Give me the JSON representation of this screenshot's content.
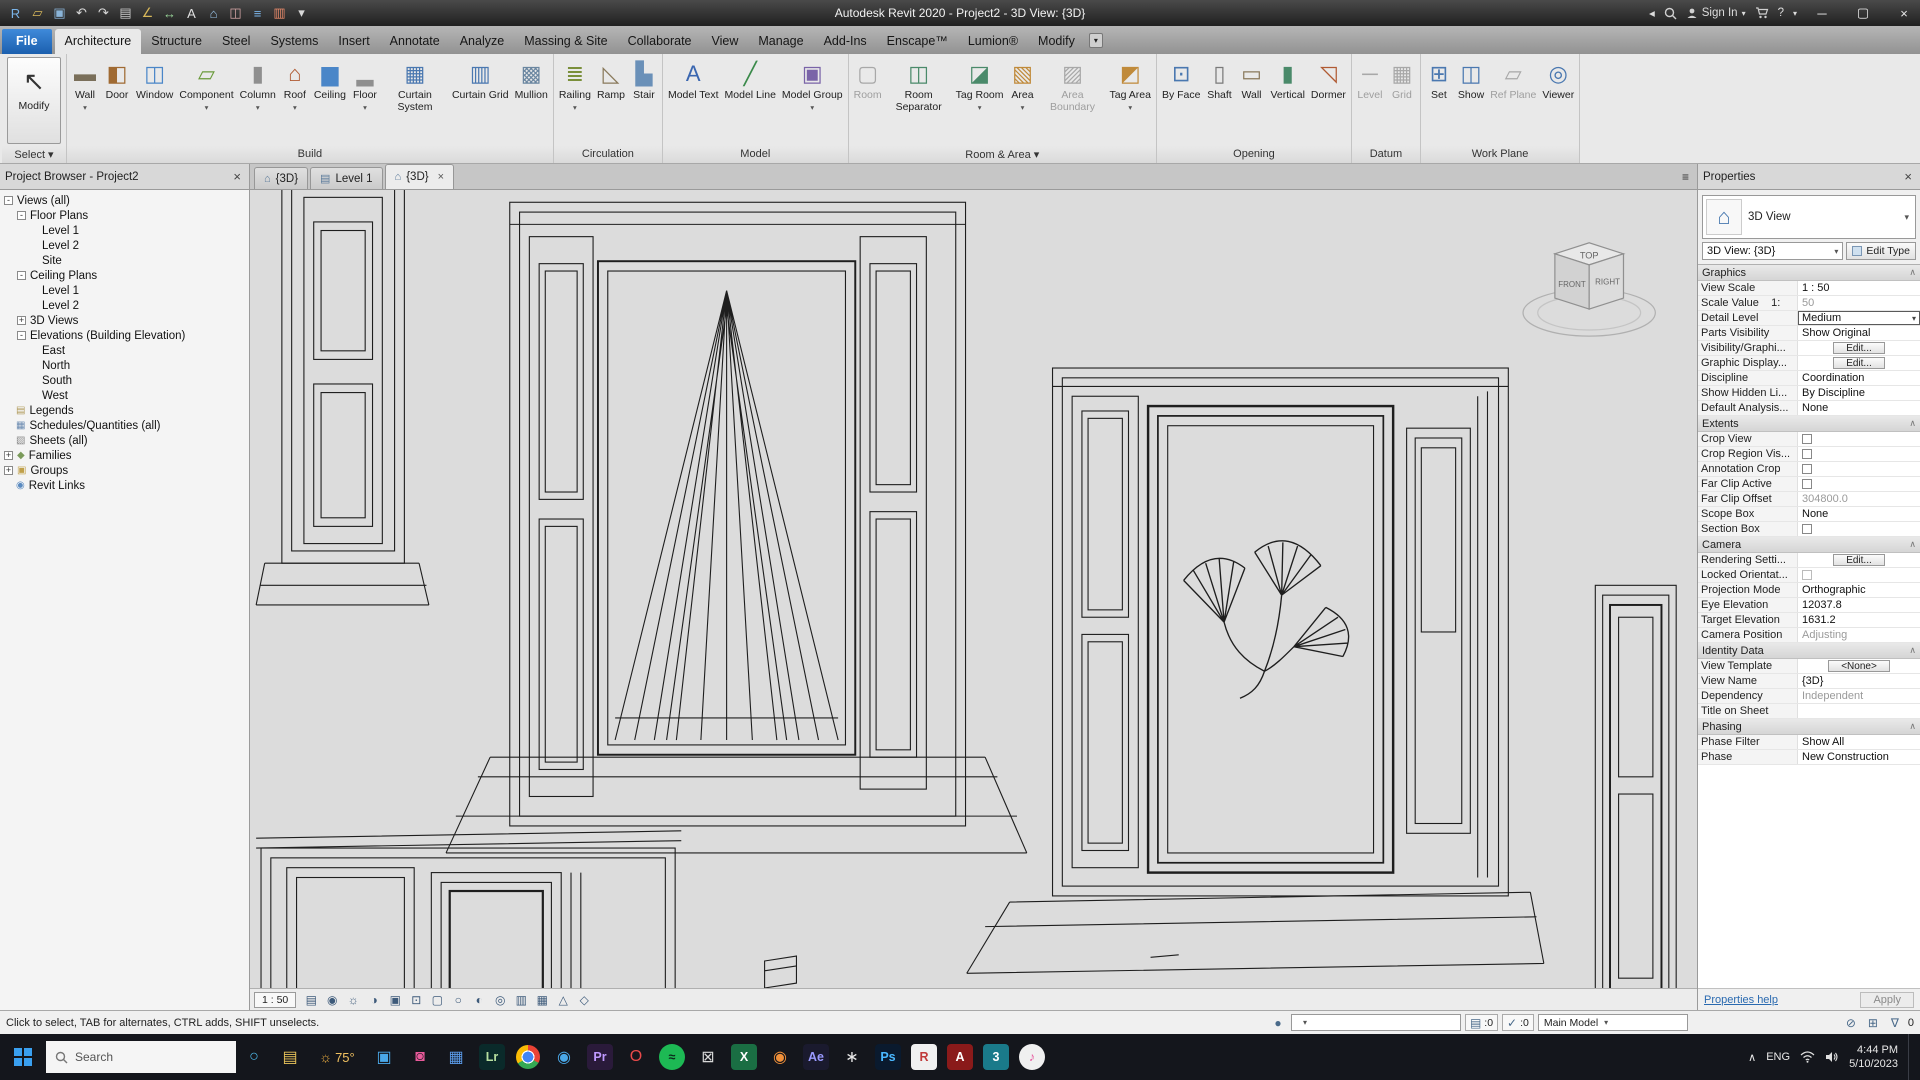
{
  "titlebar": {
    "title": "Autodesk Revit 2020 - Project2 - 3D View: {3D}",
    "qat": [
      {
        "name": "revit-logo-icon",
        "glyph": "R",
        "color": "#7ab4e8"
      },
      {
        "name": "open-icon",
        "glyph": "▱",
        "color": "#d8b85a"
      },
      {
        "name": "save-icon",
        "glyph": "▣",
        "color": "#8ab4d8"
      },
      {
        "name": "undo-icon",
        "glyph": "↶",
        "color": "#d8d8d8"
      },
      {
        "name": "redo-icon",
        "glyph": "↷",
        "color": "#d8d8d8"
      },
      {
        "name": "print-icon",
        "glyph": "▤",
        "color": "#c8c8c8"
      },
      {
        "name": "measure-icon",
        "glyph": "∠",
        "color": "#d8b85a"
      },
      {
        "name": "aligned-dimension-icon",
        "glyph": "↔",
        "color": "#9ad89a"
      },
      {
        "name": "text-note-icon",
        "glyph": "A",
        "color": "#e0e0e0"
      },
      {
        "name": "default-3d-view-icon",
        "glyph": "⌂",
        "color": "#9ac4e8"
      },
      {
        "name": "section-icon",
        "glyph": "◫",
        "color": "#d8a8a8"
      },
      {
        "name": "thin-lines-icon",
        "glyph": "≡",
        "color": "#7ab4e8"
      },
      {
        "name": "switch-windows-icon",
        "glyph": "▥",
        "color": "#e88a6a"
      },
      {
        "name": "customize-qat-icon",
        "glyph": "▾",
        "color": "#d8d8d8"
      }
    ],
    "sign_in": "Sign In",
    "help": "?"
  },
  "ribbon_tabs": [
    {
      "label": "File",
      "type": "file"
    },
    {
      "label": "Architecture",
      "active": true
    },
    {
      "label": "Structure"
    },
    {
      "label": "Steel"
    },
    {
      "label": "Systems"
    },
    {
      "label": "Insert"
    },
    {
      "label": "Annotate"
    },
    {
      "label": "Analyze"
    },
    {
      "label": "Massing & Site"
    },
    {
      "label": "Collaborate"
    },
    {
      "label": "View"
    },
    {
      "label": "Manage"
    },
    {
      "label": "Add-Ins"
    },
    {
      "label": "Enscape™"
    },
    {
      "label": "Lumion®"
    },
    {
      "label": "Modify"
    }
  ],
  "ribbon": {
    "select": {
      "tool": "Modify",
      "label": "Select"
    },
    "groups": [
      {
        "label": "Build",
        "tools": [
          {
            "label": "Wall",
            "glyph": "▬",
            "color": "#7a6f5a",
            "dd": true
          },
          {
            "label": "Door",
            "glyph": "◧",
            "color": "#a06a32"
          },
          {
            "label": "Window",
            "glyph": "◫",
            "color": "#4a86c8"
          },
          {
            "label": "Component",
            "glyph": "▱",
            "color": "#6a9a3a",
            "dd": true
          },
          {
            "label": "Column",
            "glyph": "▮",
            "color": "#8f8f8f",
            "dd": true
          },
          {
            "label": "Roof",
            "glyph": "⌂",
            "color": "#b05a32",
            "dd": true
          },
          {
            "label": "Ceiling",
            "glyph": "▆",
            "color": "#4a86c8"
          },
          {
            "label": "Floor",
            "glyph": "▂",
            "color": "#8f8f8f",
            "dd": true
          },
          {
            "label": "Curtain System",
            "glyph": "▦",
            "color": "#4a78b0"
          },
          {
            "label": "Curtain Grid",
            "glyph": "▥",
            "color": "#4a78b0"
          },
          {
            "label": "Mullion",
            "glyph": "▩",
            "color": "#6a86a0"
          }
        ]
      },
      {
        "label": "Circulation",
        "tools": [
          {
            "label": "Railing",
            "glyph": "≣",
            "color": "#7a8f3a",
            "dd": true
          },
          {
            "label": "Ramp",
            "glyph": "◺",
            "color": "#8a7a5c"
          },
          {
            "label": "Stair",
            "glyph": "▙",
            "color": "#6a90b8"
          }
        ]
      },
      {
        "label": "Model",
        "tools": [
          {
            "label": "Model Text",
            "glyph": "A",
            "color": "#3a66b0"
          },
          {
            "label": "Model Line",
            "glyph": "╱",
            "color": "#3a8a4a"
          },
          {
            "label": "Model Group",
            "glyph": "▣",
            "color": "#7a64a8",
            "dd": true
          }
        ]
      },
      {
        "label": "Room & Area",
        "dd": true,
        "tools": [
          {
            "label": "Room",
            "glyph": "▢",
            "color": "#9a9a9a",
            "disabled": true
          },
          {
            "label": "Room Separator",
            "glyph": "◫",
            "color": "#4a8a6a"
          },
          {
            "label": "Tag Room",
            "glyph": "◪",
            "color": "#4a8a6a",
            "dd": true
          },
          {
            "label": "Area",
            "glyph": "▧",
            "color": "#c08a3a",
            "dd": true
          },
          {
            "label": "Area Boundary",
            "glyph": "▨",
            "color": "#9a9a9a",
            "disabled": true
          },
          {
            "label": "Tag Area",
            "glyph": "◩",
            "color": "#c08a3a",
            "dd": true
          }
        ]
      },
      {
        "label": "Opening",
        "tools": [
          {
            "label": "By Face",
            "glyph": "⊡",
            "color": "#4a78b0"
          },
          {
            "label": "Shaft",
            "glyph": "▯",
            "color": "#7a7a7a"
          },
          {
            "label": "Wall",
            "glyph": "▭",
            "color": "#8a7a5c"
          },
          {
            "label": "Vertical",
            "glyph": "▮",
            "color": "#4a8a6a"
          },
          {
            "label": "Dormer",
            "glyph": "◹",
            "color": "#b05a32"
          }
        ]
      },
      {
        "label": "Datum",
        "tools": [
          {
            "label": "Level",
            "glyph": "─",
            "color": "#9a9a9a",
            "disabled": true
          },
          {
            "label": "Grid",
            "glyph": "▦",
            "color": "#9a9a9a",
            "disabled": true
          }
        ]
      },
      {
        "label": "Work Plane",
        "tools": [
          {
            "label": "Set",
            "glyph": "⊞",
            "color": "#4a78b0"
          },
          {
            "label": "Show",
            "glyph": "◫",
            "color": "#4a78b0"
          },
          {
            "label": "Ref Plane",
            "glyph": "▱",
            "color": "#9a9a9a",
            "disabled": true
          },
          {
            "label": "Viewer",
            "glyph": "◎",
            "color": "#4a78b0"
          }
        ]
      }
    ]
  },
  "view_tabs": [
    {
      "label": "{3D}",
      "icon": "⌂"
    },
    {
      "label": "Level 1",
      "icon": "▤"
    },
    {
      "label": "{3D}",
      "icon": "⌂",
      "active": true
    }
  ],
  "browser": {
    "title": "Project Browser - Project2",
    "items": [
      {
        "label": "Views (all)",
        "depth": 0,
        "exp": "-"
      },
      {
        "label": "Floor Plans",
        "depth": 1,
        "exp": "-"
      },
      {
        "label": "Level 1",
        "depth": 2
      },
      {
        "label": "Level 2",
        "depth": 2
      },
      {
        "label": "Site",
        "depth": 2
      },
      {
        "label": "Ceiling Plans",
        "depth": 1,
        "exp": "-"
      },
      {
        "label": "Level 1",
        "depth": 2
      },
      {
        "label": "Level 2",
        "depth": 2
      },
      {
        "label": "3D Views",
        "depth": 1,
        "exp": "+"
      },
      {
        "label": "Elevations (Building Elevation)",
        "depth": 1,
        "exp": "-"
      },
      {
        "label": "East",
        "depth": 2
      },
      {
        "label": "North",
        "depth": 2
      },
      {
        "label": "South",
        "depth": 2
      },
      {
        "label": "West",
        "depth": 2
      },
      {
        "label": "Legends",
        "depth": 0,
        "glyph": "▤",
        "color": "#b09a5a"
      },
      {
        "label": "Schedules/Quantities (all)",
        "depth": 0,
        "glyph": "▦",
        "color": "#6a8ab0"
      },
      {
        "label": "Sheets (all)",
        "depth": 0,
        "glyph": "▧",
        "color": "#8a8a8a"
      },
      {
        "label": "Families",
        "depth": 0,
        "exp": "+",
        "glyph": "◆",
        "color": "#7a9a5a"
      },
      {
        "label": "Groups",
        "depth": 0,
        "exp": "+",
        "glyph": "▣",
        "color": "#c0a04a"
      },
      {
        "label": "Revit Links",
        "depth": 0,
        "glyph": "◉",
        "color": "#5a8ac0"
      }
    ]
  },
  "properties": {
    "title": "Properties",
    "type_category": "3D View",
    "instance": "3D View: {3D}",
    "edit_type": "Edit Type",
    "sections": [
      {
        "title": "Graphics",
        "rows": [
          {
            "name": "View Scale",
            "value": "1 : 50"
          },
          {
            "name": "Scale Value    1:",
            "value": "50",
            "disabled": true
          },
          {
            "name": "Detail Level",
            "value": "Medium",
            "editing": true
          },
          {
            "name": "Parts Visibility",
            "value": "Show Original"
          },
          {
            "name": "Visibility/Graphi...",
            "value": "Edit...",
            "type": "button"
          },
          {
            "name": "Graphic Display...",
            "value": "Edit...",
            "type": "button"
          },
          {
            "name": "Discipline",
            "value": "Coordination"
          },
          {
            "name": "Show Hidden Li...",
            "value": "By Discipline"
          },
          {
            "name": "Default Analysis...",
            "value": "None"
          }
        ]
      },
      {
        "title": "Extents",
        "rows": [
          {
            "name": "Crop View",
            "type": "checkbox"
          },
          {
            "name": "Crop Region Vis...",
            "type": "checkbox"
          },
          {
            "name": "Annotation Crop",
            "type": "checkbox"
          },
          {
            "name": "Far Clip Active",
            "type": "checkbox"
          },
          {
            "name": "Far Clip Offset",
            "value": "304800.0",
            "disabled": true
          },
          {
            "name": "Scope Box",
            "value": "None"
          },
          {
            "name": "Section Box",
            "type": "checkbox"
          }
        ]
      },
      {
        "title": "Camera",
        "rows": [
          {
            "name": "Rendering Setti...",
            "value": "Edit...",
            "type": "button"
          },
          {
            "name": "Locked Orientat...",
            "type": "checkbox",
            "disabled": true
          },
          {
            "name": "Projection Mode",
            "value": "Orthographic"
          },
          {
            "name": "Eye Elevation",
            "value": "12037.8"
          },
          {
            "name": "Target Elevation",
            "value": "1631.2"
          },
          {
            "name": "Camera Position",
            "value": "Adjusting",
            "disabled": true
          }
        ]
      },
      {
        "title": "Identity Data",
        "rows": [
          {
            "name": "View Template",
            "value": "<None>",
            "type": "button"
          },
          {
            "name": "View Name",
            "value": "{3D}"
          },
          {
            "name": "Dependency",
            "value": "Independent",
            "disabled": true
          },
          {
            "name": "Title on Sheet",
            "value": ""
          }
        ]
      },
      {
        "title": "Phasing",
        "rows": [
          {
            "name": "Phase Filter",
            "value": "Show All"
          },
          {
            "name": "Phase",
            "value": "New Construction"
          }
        ]
      }
    ],
    "help": "Properties help",
    "apply": "Apply"
  },
  "viewcube": {
    "top": "TOP",
    "front": "FRONT",
    "right": "RIGHT"
  },
  "viewbar": {
    "scale": "1 : 50",
    "icons": [
      {
        "name": "detail-level-icon",
        "glyph": "▤"
      },
      {
        "name": "visual-style-icon",
        "glyph": "◉"
      },
      {
        "name": "sun-path-icon",
        "glyph": "☼"
      },
      {
        "name": "shadows-icon",
        "glyph": "◑"
      },
      {
        "name": "rendering-dialog-icon",
        "glyph": "▣"
      },
      {
        "name": "crop-view-icon",
        "glyph": "⊡"
      },
      {
        "name": "show-crop-region-icon",
        "glyph": "▢"
      },
      {
        "name": "lock-3d-view-icon",
        "glyph": "○"
      },
      {
        "name": "temporary-hide-isolate-icon",
        "glyph": "◐"
      },
      {
        "name": "reveal-hidden-elements-icon",
        "glyph": "◎"
      },
      {
        "name": "worksharing-display-icon",
        "glyph": "▥"
      },
      {
        "name": "temporary-view-properties-icon",
        "glyph": "▦"
      },
      {
        "name": "analytical-model-icon",
        "glyph": "△"
      },
      {
        "name": "displacement-sets-icon",
        "glyph": "◇"
      }
    ]
  },
  "statusbar": {
    "hint": "Click to select, TAB for alternates, CTRL adds, SHIFT unselects.",
    "badge1": ":0",
    "badge2": ":0",
    "design_option": "Main Model",
    "selection_count": "0"
  },
  "taskbar": {
    "search": "Search",
    "apps": [
      {
        "name": "cortana",
        "glyph": "○",
        "fg": "#4db8e8"
      },
      {
        "name": "file-explorer",
        "glyph": "▤",
        "fg": "#e8c35a"
      },
      {
        "name": "weather",
        "glyph": "75°",
        "fg": "#f0c060",
        "wide": true
      },
      {
        "name": "video-chat",
        "glyph": "▣",
        "fg": "#4aa8e8"
      },
      {
        "name": "instagram",
        "glyph": "◙",
        "fg": "#e85a9a"
      },
      {
        "name": "photos",
        "glyph": "▦",
        "fg": "#5a9ae8"
      },
      {
        "name": "lightroom",
        "glyph": "Lr",
        "bg": "#0a2a2a",
        "fg": "#b8e0a0"
      },
      {
        "name": "chrome",
        "glyph": "",
        "special": "chrome"
      },
      {
        "name": "safari",
        "glyph": "◉",
        "fg": "#4aa8e8"
      },
      {
        "name": "premiere",
        "glyph": "Pr",
        "bg": "#2a1a3a",
        "fg": "#c09aff"
      },
      {
        "name": "opera",
        "glyph": "O",
        "fg": "#e84a4a"
      },
      {
        "name": "spotify",
        "glyph": "≈",
        "bg": "#1db954",
        "fg": "#0a2a1a",
        "round": true
      },
      {
        "name": "mail",
        "glyph": "⊠",
        "fg": "#d8d8d8"
      },
      {
        "name": "excel",
        "glyph": "X",
        "bg": "#1a6e43",
        "fg": "#ffffff"
      },
      {
        "name": "firefox",
        "glyph": "◉",
        "fg": "#f0903a"
      },
      {
        "name": "after-effects",
        "glyph": "Ae",
        "bg": "#1a1a2e",
        "fg": "#9a9aff"
      },
      {
        "name": "paw-app",
        "glyph": "∗",
        "fg": "#e8e8e8"
      },
      {
        "name": "photoshop",
        "glyph": "Ps",
        "bg": "#0a1a2e",
        "fg": "#4ab8ff"
      },
      {
        "name": "revit",
        "glyph": "R",
        "bg": "#f0f0f0",
        "fg": "#c03a3a"
      },
      {
        "name": "autocad",
        "glyph": "A",
        "bg": "#8a1a1a",
        "fg": "#ffffff"
      },
      {
        "name": "3ds-max",
        "glyph": "3",
        "bg": "#1a7a8a",
        "fg": "#ffffff"
      },
      {
        "name": "itunes",
        "glyph": "♪",
        "bg": "#f0f0f0",
        "fg": "#e85aa0",
        "round": true
      }
    ],
    "lang": "ENG",
    "time": "4:44 PM",
    "date": "5/10/2023"
  }
}
